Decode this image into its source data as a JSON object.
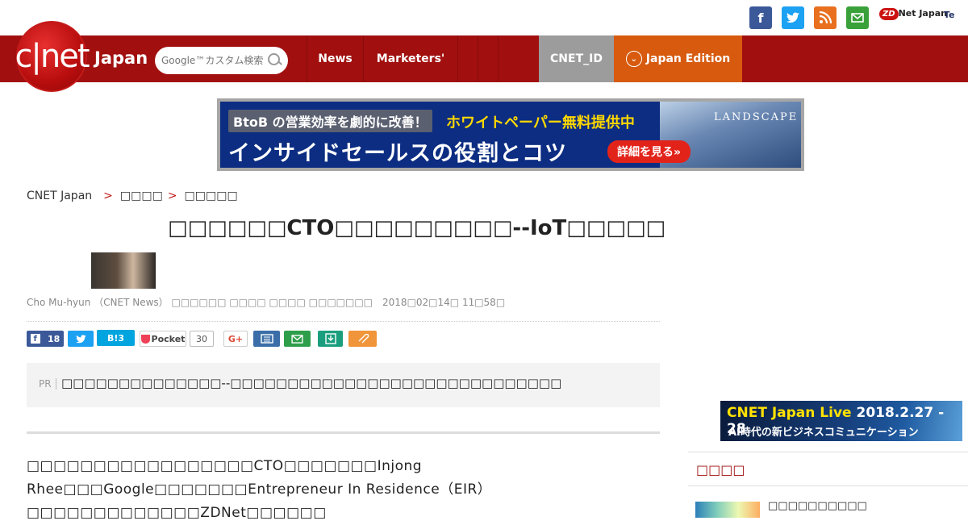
{
  "header": {
    "social_icons": [
      {
        "name": "facebook-icon",
        "color": "#3b5998",
        "glyph": "f"
      },
      {
        "name": "twitter-icon",
        "color": "#1da1f2",
        "glyph": "t"
      },
      {
        "name": "rss-icon",
        "color": "#e8701f",
        "glyph": "))"
      },
      {
        "name": "mail-icon",
        "color": "#3aa13a",
        "glyph": "✉"
      }
    ],
    "zdnet_mark": "ZD",
    "zdnet_label": "Net Japan",
    "te_label": "Te"
  },
  "nav": {
    "logo_text": "c|net",
    "logo_sub": "Japan",
    "search_placeholder": "Google™カスタム検索",
    "links": [
      {
        "label": "News",
        "width": 70
      },
      {
        "label": "Marketers'",
        "width": 117
      },
      {
        "label": "",
        "width": 25
      },
      {
        "label": "",
        "width": 25
      },
      {
        "label": "",
        "width": 25
      }
    ],
    "cnet_id": "CNET_ID",
    "edition": "Japan Edition",
    "colors": {
      "bar": "#a10f0f",
      "cnet_id": "#9c9c9c",
      "edition": "#d75a0e"
    }
  },
  "ad_banner": {
    "tag": "BtoB の営業効率を劇的に改善！",
    "highlight": "ホワイトペーパー無料提供中",
    "headline": "インサイドセールスの役割とコツ",
    "cta": "詳細を見る»",
    "brand": "LANDSCAPE"
  },
  "breadcrumb": {
    "home": "CNET Japan",
    "sep": ">",
    "level1": "□□□□",
    "level2": "□□□□□"
  },
  "article": {
    "title": "□□□□□□CTO□□□□□□□□□--IoT□□□□□",
    "byline": "Cho Mu-hyun （CNET News） □□□□□□ □□□□ □□□□ □□□□□□□",
    "date": "2018□02□14□ 11□58□",
    "shares": {
      "facebook": "18",
      "hatena": "B!3",
      "pocket_label": "Pocket",
      "pocket_count": "30",
      "gplus": "G+"
    },
    "pr_label": "PR",
    "pr_text": "□□□□□□□□□□□□□□--□□□□□□□□□□□□□□□□□□□□□□□□□□□□□",
    "body": "□□□□□□□□□□□□□□□□□CTO□□□□□□□Injong Rhee□□□Google□□□□□□□Entrepreneur In Residence（EIR）□□□□□□□□□□□□□ZDNet□□□□□□"
  },
  "sidebar": {
    "event_banner_title": "CNET Japan Live",
    "event_banner_date": "2018.2.27 - 28",
    "event_banner_sub": "AI時代の新ビジネスコミュニケーション",
    "section_title": "□□□□",
    "item_text": "□□□□□□□□□□"
  }
}
